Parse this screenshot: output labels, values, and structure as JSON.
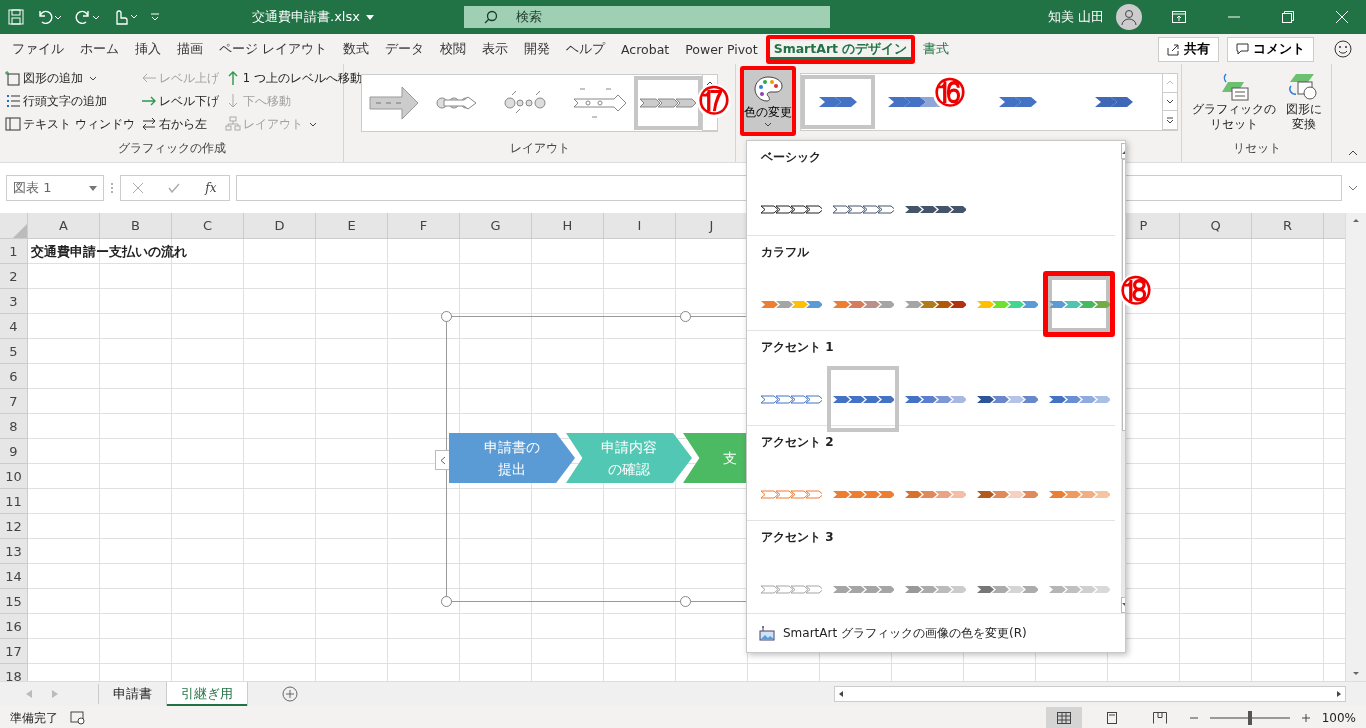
{
  "title_bar": {
    "filename": "交通費申請書.xlsx",
    "search_placeholder": "検索",
    "user": "知美 山田"
  },
  "menu_tabs": [
    {
      "label": "ファイル",
      "selected": false,
      "kind": "normal",
      "highlighted": false
    },
    {
      "label": "ホーム",
      "selected": false,
      "kind": "normal",
      "highlighted": false
    },
    {
      "label": "挿入",
      "selected": false,
      "kind": "normal",
      "highlighted": false
    },
    {
      "label": "描画",
      "selected": false,
      "kind": "normal",
      "highlighted": false
    },
    {
      "label": "ページ レイアウト",
      "selected": false,
      "kind": "normal",
      "highlighted": false
    },
    {
      "label": "数式",
      "selected": false,
      "kind": "normal",
      "highlighted": false
    },
    {
      "label": "データ",
      "selected": false,
      "kind": "normal",
      "highlighted": false
    },
    {
      "label": "校閲",
      "selected": false,
      "kind": "normal",
      "highlighted": false
    },
    {
      "label": "表示",
      "selected": false,
      "kind": "normal",
      "highlighted": false
    },
    {
      "label": "開発",
      "selected": false,
      "kind": "normal",
      "highlighted": false
    },
    {
      "label": "ヘルプ",
      "selected": false,
      "kind": "normal",
      "highlighted": false
    },
    {
      "label": "Acrobat",
      "selected": false,
      "kind": "normal",
      "highlighted": false
    },
    {
      "label": "Power Pivot",
      "selected": false,
      "kind": "normal",
      "highlighted": false
    },
    {
      "label": "SmartArt のデザイン",
      "selected": true,
      "kind": "contextual",
      "highlighted": true
    },
    {
      "label": "書式",
      "selected": false,
      "kind": "contextual",
      "highlighted": false
    }
  ],
  "share_button": "共有",
  "comment_button": "コメント",
  "create_group": {
    "label": "グラフィックの作成",
    "columns": [
      [
        {
          "label": "図形の追加",
          "disabled": false,
          "has_menu": true
        },
        {
          "label": "行頭文字の追加",
          "disabled": false,
          "has_menu": false
        },
        {
          "label": "テキスト ウィンドウ",
          "disabled": false,
          "has_menu": false
        }
      ],
      [
        {
          "label": "レベル上げ",
          "disabled": true,
          "has_menu": false
        },
        {
          "label": "レベル下げ",
          "disabled": false,
          "has_menu": false
        },
        {
          "label": "右から左",
          "disabled": false,
          "has_menu": false
        }
      ],
      [
        {
          "label": "1 つ上のレベルへ移動",
          "disabled": false,
          "has_menu": false
        },
        {
          "label": "下へ移動",
          "disabled": true,
          "has_menu": false
        },
        {
          "label": "レイアウト",
          "disabled": true,
          "has_menu": true
        }
      ]
    ]
  },
  "layout_group": {
    "label": "レイアウト",
    "layouts": [
      {
        "selected": false
      },
      {
        "selected": false
      },
      {
        "selected": false
      },
      {
        "selected": false
      },
      {
        "selected": true
      }
    ]
  },
  "styles_group": {
    "color_button": {
      "label": "色の変更",
      "highlighted": true
    },
    "styles": [
      {
        "selected": true,
        "colors": [
          {
            "color": "#4472c4"
          },
          {
            "color": "#4472c4"
          }
        ]
      },
      {
        "selected": false,
        "colors": [
          {
            "color": "#4472c4"
          },
          {
            "color": "#4472c4"
          },
          {
            "color": "#8fa5d8"
          },
          {
            "color": "#8fa5d8"
          }
        ]
      },
      {
        "selected": false,
        "colors": [
          {
            "color": "#4472c4"
          },
          {
            "color": "#4472c4"
          }
        ]
      },
      {
        "selected": false,
        "colors": [
          {
            "color": "#3f68b8"
          },
          {
            "color": "#3f68b8"
          }
        ]
      }
    ]
  },
  "reset_group": {
    "label": "リセット",
    "buttons": [
      {
        "lines": [
          "グラフィックの",
          "リセット"
        ]
      },
      {
        "lines": [
          "図形に",
          "変換"
        ]
      }
    ]
  },
  "callouts": [
    {
      "label": "⑯"
    },
    {
      "label": "⑰"
    },
    {
      "label": "⑱"
    }
  ],
  "formula_bar": {
    "name_box": "図表 1",
    "fx": "fx"
  },
  "sheet": {
    "columns": [
      "A",
      "B",
      "C",
      "D",
      "E",
      "F",
      "G",
      "H",
      "I",
      "J"
    ],
    "columns_right": [
      "P",
      "Q",
      "R"
    ],
    "rows": [
      "1",
      "2",
      "3",
      "4",
      "5",
      "6",
      "7",
      "8",
      "9",
      "10",
      "11",
      "12",
      "13",
      "14",
      "15",
      "16",
      "17",
      "18"
    ],
    "a1": "交通費申請ー支払いの流れ"
  },
  "smartart": [
    {
      "lines": [
        "申請書の",
        "提出"
      ],
      "color": "#5b9bd5"
    },
    {
      "lines": [
        "申請内容",
        "の確認"
      ],
      "color": "#52c7b3"
    },
    {
      "lines": [
        "支"
      ],
      "color": "#4cb963"
    }
  ],
  "color_menu": {
    "sections": [
      {
        "title": "ベーシック",
        "options": [
          {
            "kind": "outline",
            "colors": [
              {
                "color": "#222222"
              }
            ],
            "selected": false,
            "hovered": false,
            "highlighted": false
          },
          {
            "kind": "outline",
            "colors": [
              {
                "color": "#44546a"
              }
            ],
            "selected": false,
            "hovered": false,
            "highlighted": false
          },
          {
            "kind": "filled",
            "colors": [
              {
                "color": "#44546a"
              }
            ],
            "selected": false,
            "hovered": false,
            "highlighted": false
          }
        ]
      },
      {
        "title": "カラフル",
        "options": [
          {
            "kind": "filled",
            "colors": [
              {
                "color": "#ed7d31"
              },
              {
                "color": "#a5a5a5"
              },
              {
                "color": "#ffc000"
              },
              {
                "color": "#5b9bd5"
              }
            ],
            "selected": false,
            "hovered": false,
            "highlighted": false
          },
          {
            "kind": "filled",
            "colors": [
              {
                "color": "#ed7d31"
              },
              {
                "color": "#d57c5f"
              },
              {
                "color": "#b9918a"
              },
              {
                "color": "#a5a5a5"
              }
            ],
            "selected": false,
            "hovered": false,
            "highlighted": false
          },
          {
            "kind": "filled",
            "colors": [
              {
                "color": "#a5a5a5"
              },
              {
                "color": "#b07a1c"
              },
              {
                "color": "#b0570a"
              },
              {
                "color": "#b03010"
              }
            ],
            "selected": false,
            "hovered": false,
            "highlighted": false
          },
          {
            "kind": "filled",
            "colors": [
              {
                "color": "#ffc000"
              },
              {
                "color": "#70e030"
              },
              {
                "color": "#40d890"
              },
              {
                "color": "#5b9bd5"
              }
            ],
            "selected": false,
            "hovered": false,
            "highlighted": false
          },
          {
            "kind": "filled",
            "colors": [
              {
                "color": "#5b9bd5"
              },
              {
                "color": "#4fc5b0"
              },
              {
                "color": "#46b860"
              },
              {
                "color": "#70ad47"
              }
            ],
            "selected": false,
            "hovered": true,
            "highlighted": true
          }
        ]
      },
      {
        "title": "アクセント 1",
        "options": [
          {
            "kind": "outline",
            "colors": [
              {
                "color": "#4472c4"
              }
            ],
            "selected": false,
            "hovered": false,
            "highlighted": false
          },
          {
            "kind": "filled",
            "colors": [
              {
                "color": "#4472c4"
              }
            ],
            "selected": true,
            "hovered": false,
            "highlighted": false
          },
          {
            "kind": "filled",
            "colors": [
              {
                "color": "#4472c4"
              },
              {
                "color": "#5b7fd0"
              },
              {
                "color": "#8097d6"
              },
              {
                "color": "#a9b8e2"
              }
            ],
            "selected": false,
            "hovered": false,
            "highlighted": false
          },
          {
            "kind": "filled",
            "colors": [
              {
                "color": "#2f5597"
              },
              {
                "color": "#6a87cc"
              },
              {
                "color": "#b4c3e6"
              },
              {
                "color": "#6a87cd"
              }
            ],
            "selected": false,
            "hovered": false,
            "highlighted": false
          },
          {
            "kind": "filled",
            "colors": [
              {
                "color": "#4472c4"
              },
              {
                "color": "#6b8fd4"
              },
              {
                "color": "#8eaadf"
              },
              {
                "color": "#a9bfe6"
              }
            ],
            "selected": false,
            "hovered": false,
            "highlighted": false
          }
        ]
      },
      {
        "title": "アクセント 2",
        "options": [
          {
            "kind": "outline",
            "colors": [
              {
                "color": "#ed7d31"
              }
            ],
            "selected": false,
            "hovered": false,
            "highlighted": false
          },
          {
            "kind": "filled",
            "colors": [
              {
                "color": "#ed7d31"
              }
            ],
            "selected": false,
            "hovered": false,
            "highlighted": false
          },
          {
            "kind": "filled",
            "colors": [
              {
                "color": "#d9712b"
              },
              {
                "color": "#e0895a"
              },
              {
                "color": "#eba383"
              },
              {
                "color": "#f3bea5"
              }
            ],
            "selected": false,
            "hovered": false,
            "highlighted": false
          },
          {
            "kind": "filled",
            "colors": [
              {
                "color": "#b05a20"
              },
              {
                "color": "#e08a5a"
              },
              {
                "color": "#f6d0c0"
              },
              {
                "color": "#e08a5b"
              }
            ],
            "selected": false,
            "hovered": false,
            "highlighted": false
          },
          {
            "kind": "filled",
            "colors": [
              {
                "color": "#ed7d31"
              },
              {
                "color": "#f09a5d"
              },
              {
                "color": "#f2ad80"
              },
              {
                "color": "#f5c4a0"
              }
            ],
            "selected": false,
            "hovered": false,
            "highlighted": false
          }
        ]
      },
      {
        "title": "アクセント 3",
        "options": [
          {
            "kind": "outline",
            "colors": [
              {
                "color": "#a5a5a5"
              }
            ],
            "selected": false,
            "hovered": false,
            "highlighted": false
          },
          {
            "kind": "filled",
            "colors": [
              {
                "color": "#a5a5a5"
              }
            ],
            "selected": false,
            "hovered": false,
            "highlighted": false
          },
          {
            "kind": "filled",
            "colors": [
              {
                "color": "#999999"
              },
              {
                "color": "#aaaaaa"
              },
              {
                "color": "#bbbbbb"
              },
              {
                "color": "#cccccc"
              }
            ],
            "selected": false,
            "hovered": false,
            "highlighted": false
          },
          {
            "kind": "filled",
            "colors": [
              {
                "color": "#777777"
              },
              {
                "color": "#ababab"
              },
              {
                "color": "#d5d5d5"
              },
              {
                "color": "#acacac"
              }
            ],
            "selected": false,
            "hovered": false,
            "highlighted": false
          },
          {
            "kind": "filled",
            "colors": [
              {
                "color": "#b5b5b5"
              },
              {
                "color": "#c0c0c0"
              },
              {
                "color": "#cfcfcf"
              },
              {
                "color": "#d9d9d9"
              }
            ],
            "selected": false,
            "hovered": false,
            "highlighted": false
          }
        ]
      }
    ],
    "footer": "SmartArt グラフィックの画像の色を変更(R)"
  },
  "sheet_tabs": [
    {
      "label": "申請書",
      "selected": false
    },
    {
      "label": "引継ぎ用",
      "selected": true
    }
  ],
  "status_bar": {
    "status": "準備完了",
    "views": [
      {
        "selected": true
      },
      {
        "selected": false
      },
      {
        "selected": false
      }
    ],
    "zoom_slider": {
      "level": 0.5
    },
    "zoom": "100%"
  }
}
